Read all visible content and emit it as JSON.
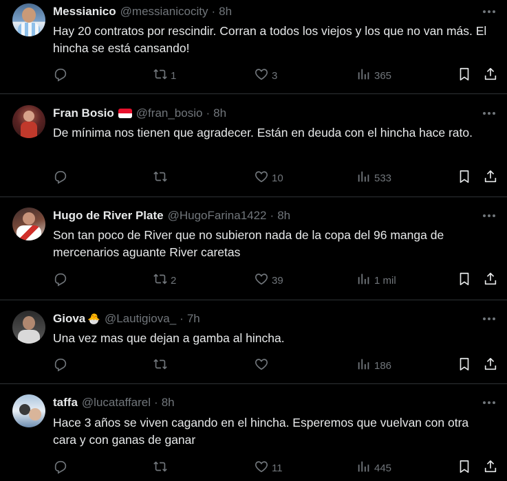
{
  "tweets": [
    {
      "name": "Messianico",
      "handle": "@messianicocity",
      "time": "8h",
      "text": "Hay 20 contratos por rescindir. Corran a todos los viejos y los que no van más. El hincha se está cansando!",
      "replies": "",
      "retweets": "1",
      "likes": "3",
      "views": "365",
      "avatar_color": "#5a7fa8"
    },
    {
      "name": "Fran Bosio",
      "handle": "@fran_bosio",
      "time": "8h",
      "text": "De mínima nos tienen que agradecer. Están en deuda con el hincha hace rato.",
      "replies": "",
      "retweets": "",
      "likes": "10",
      "views": "533",
      "avatar_color": "#6b2b2b"
    },
    {
      "name": "Hugo de River Plate",
      "handle": "@HugoFarina1422",
      "time": "8h",
      "text": "Son tan poco de River que no subieron nada de la copa del 96 manga de mercenarios aguante River caretas",
      "replies": "",
      "retweets": "2",
      "likes": "39",
      "views": "1 mil",
      "avatar_color": "#b0413e"
    },
    {
      "name": "Giova",
      "handle": "@Lautigiova_",
      "time": "7h",
      "text": "Una vez mas que dejan a gamba al hincha.",
      "replies": "",
      "retweets": "",
      "likes": "",
      "views": "186",
      "avatar_color": "#4a4a4a"
    },
    {
      "name": "taffa",
      "handle": "@lucataffarel",
      "time": "8h",
      "text": "Hace 3 años se viven cagando en el hincha. Esperemos que vuelvan con otra cara y con ganas de ganar",
      "replies": "",
      "retweets": "",
      "likes": "11",
      "views": "445",
      "avatar_color": "#7d98b5"
    }
  ],
  "colors": {
    "background": "#000000",
    "text": "#e7e9ea",
    "muted": "#71767b",
    "divider": "#2f3336"
  }
}
